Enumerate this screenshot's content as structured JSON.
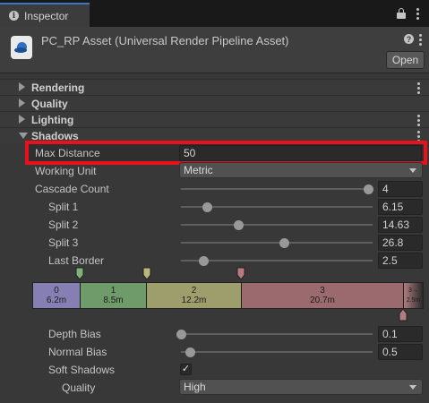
{
  "tab": {
    "title": "Inspector"
  },
  "header": {
    "asset_title": "PC_RP Asset (Universal Render Pipeline Asset)",
    "open_label": "Open"
  },
  "sections": [
    {
      "label": "Rendering",
      "expanded": false
    },
    {
      "label": "Quality",
      "expanded": false
    },
    {
      "label": "Lighting",
      "expanded": false
    },
    {
      "label": "Shadows",
      "expanded": true
    }
  ],
  "shadows": {
    "max_distance": {
      "label": "Max Distance",
      "value": "50"
    },
    "working_unit": {
      "label": "Working Unit",
      "value": "Metric"
    },
    "cascade_count": {
      "label": "Cascade Count",
      "value": "4",
      "fraction": 0.98
    },
    "splits": [
      {
        "label": "Split 1",
        "value": "6.15",
        "fraction": 0.14
      },
      {
        "label": "Split 2",
        "value": "14.63",
        "fraction": 0.3
      },
      {
        "label": "Split 3",
        "value": "26.8",
        "fraction": 0.54
      },
      {
        "label": "Last Border",
        "value": "2.5",
        "fraction": 0.12
      }
    ],
    "cascades": [
      {
        "index": "0",
        "dist": "6.2m",
        "color": "#857fb4"
      },
      {
        "index": "1",
        "dist": "8.5m",
        "color": "#6f9a6a"
      },
      {
        "index": "2",
        "dist": "12.2m",
        "color": "#9e9e6d"
      },
      {
        "index": "3",
        "dist": "20.7m",
        "color": "#9a6a6f"
      },
      {
        "index": "3→",
        "dist": "2.5m",
        "color": "#b07d80"
      }
    ],
    "depth_bias": {
      "label": "Depth Bias",
      "value": "0.1",
      "fraction": 0.0
    },
    "normal_bias": {
      "label": "Normal Bias",
      "value": "0.5",
      "fraction": 0.05
    },
    "soft_shadows": {
      "label": "Soft Shadows",
      "checked": true,
      "check_glyph": "✓"
    },
    "quality": {
      "label": "Quality",
      "value": "High"
    }
  },
  "icons": {
    "info": "i",
    "help": "?"
  }
}
